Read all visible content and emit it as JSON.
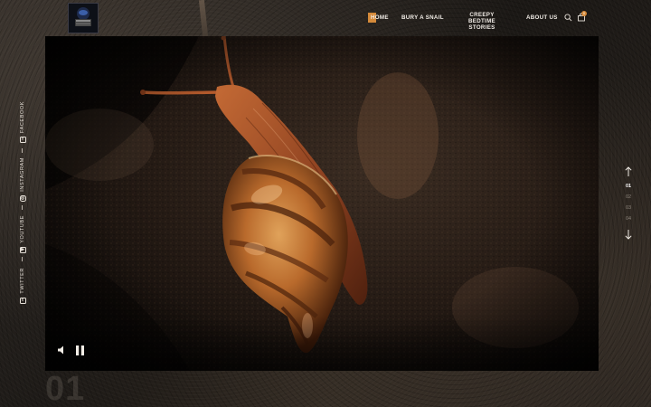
{
  "header": {
    "logo_name": "site-logo",
    "nav": [
      {
        "label": "HOME"
      },
      {
        "label": "BURY A SNAIL"
      },
      {
        "label": "CREEPY BEDTIME"
      },
      {
        "label": "STORIES"
      },
      {
        "label": "ABOUT US"
      }
    ],
    "icons": {
      "search": "search-icon",
      "cart": "shopping-bag-icon"
    },
    "cart_count": "0",
    "accent_color": "#d58a3a"
  },
  "social": [
    {
      "label": "FACEBOOK",
      "icon_glyph": "f",
      "icon": "facebook-icon"
    },
    {
      "label": "INSTAGRAM",
      "icon_glyph": "◎",
      "icon": "instagram-icon"
    },
    {
      "label": "YOUTUBE",
      "icon_glyph": "▶",
      "icon": "youtube-icon"
    },
    {
      "label": "TWITTER",
      "icon_glyph": "t",
      "icon": "twitter-icon"
    }
  ],
  "video": {
    "subject": "snail",
    "controls": {
      "mute": "volume-icon",
      "pause": "pause-icon"
    }
  },
  "slider": {
    "slides": [
      "01",
      "02",
      "03",
      "04"
    ],
    "active": "01",
    "up_icon": "arrow-up-icon",
    "down_icon": "arrow-down-icon",
    "big_number": "01"
  }
}
